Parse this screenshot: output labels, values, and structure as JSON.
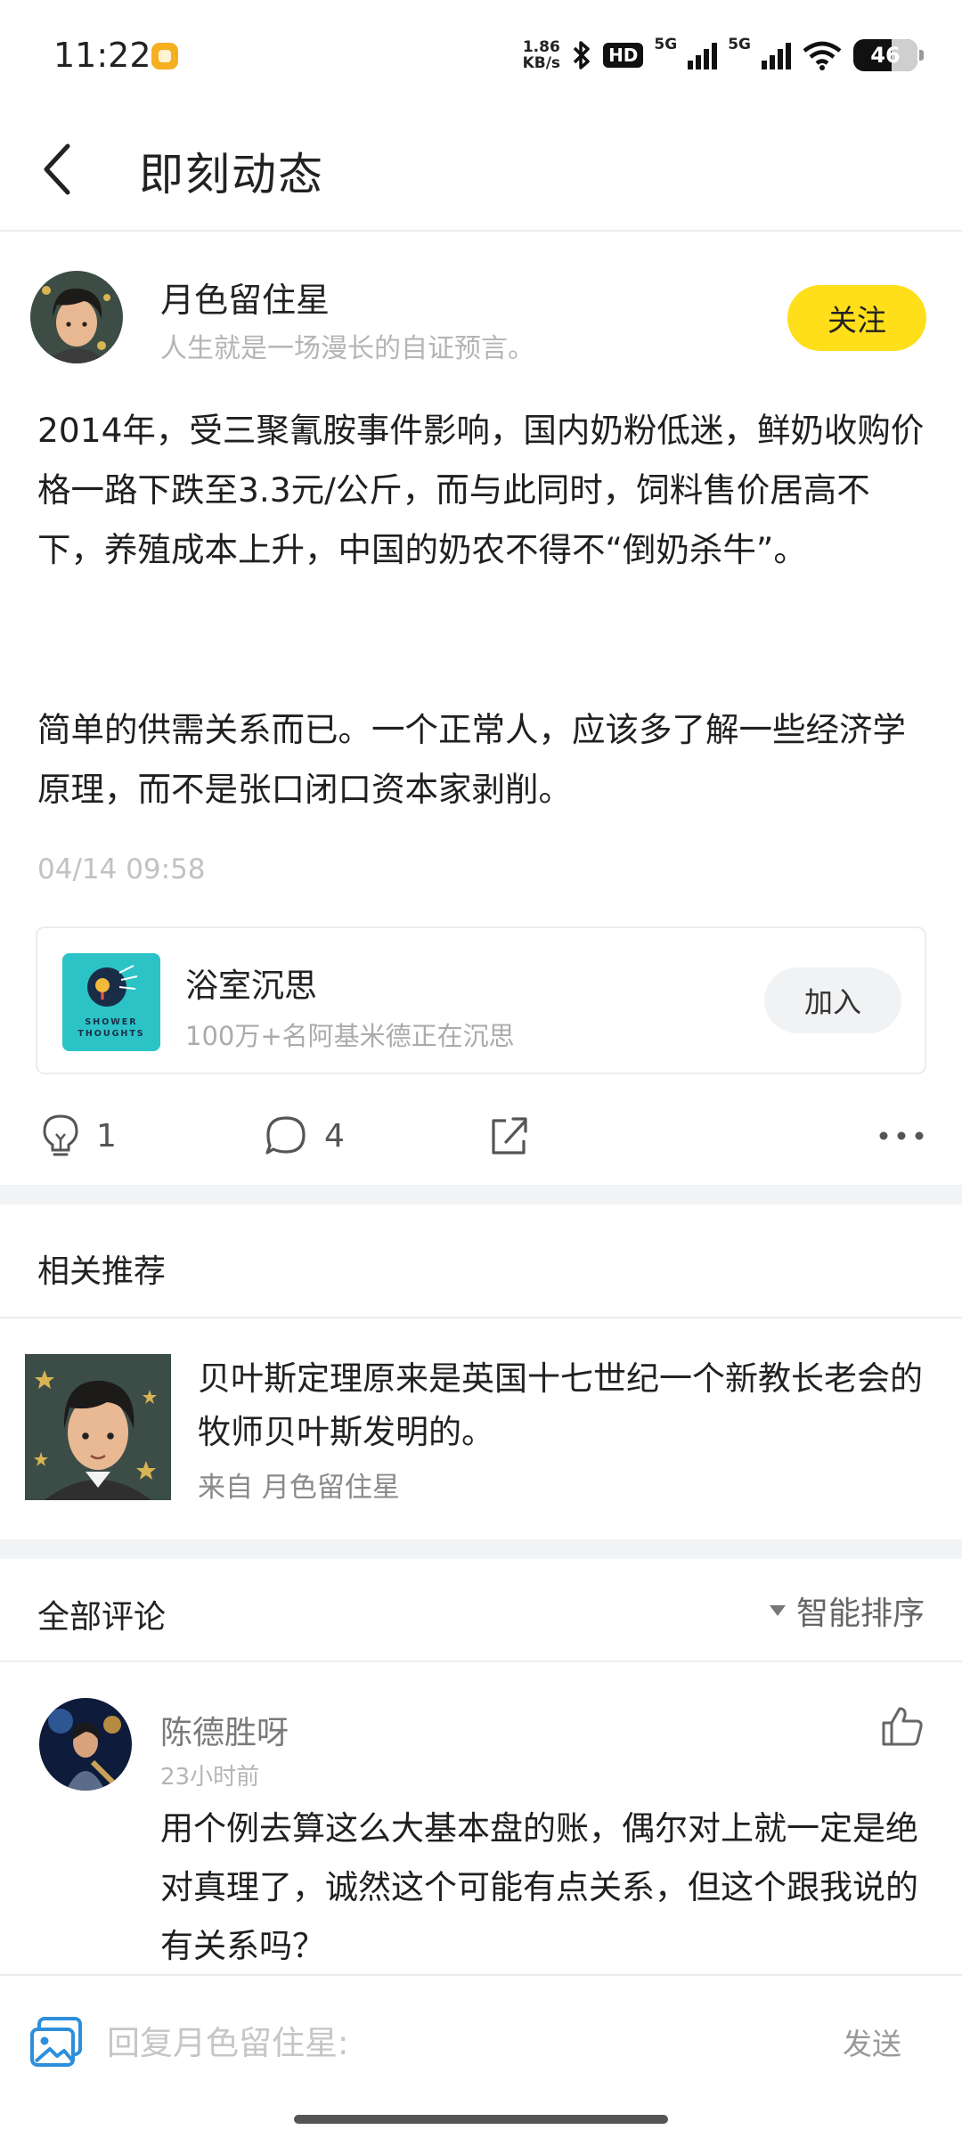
{
  "status_bar": {
    "time": "11:22",
    "net_speed_value": "1.86",
    "net_speed_unit": "KB/s",
    "hd_label": "HD",
    "net1": "5G",
    "net2": "5G",
    "battery": "46"
  },
  "header": {
    "title": "即刻动态"
  },
  "post": {
    "author_name": "月色留住星",
    "author_signature": "人生就是一场漫长的自证预言。",
    "follow_label": "关注",
    "paragraph1": "2014年，受三聚氰胺事件影响，国内奶粉低迷，鲜奶收购价格一路下跌至3.3元/公斤，而与此同时，饲料售价居高不下，养殖成本上升，中国的奶农不得不“倒奶杀牛”。",
    "paragraph2": "简单的供需关系而已。一个正常人，应该多了解一些经济学原理，而不是张口闭口资本家剥削。",
    "time": "04/14 09:58"
  },
  "topic": {
    "name": "浴室沉思",
    "desc": "100万+名阿基米德正在沉思",
    "logo_text_line1": "SHOWER",
    "logo_text_line2": "THOUGHTS",
    "join_label": "加入",
    "brand_color": "#2cc3c6"
  },
  "actions": {
    "like_count": "1",
    "comment_count": "4"
  },
  "related": {
    "section_title": "相关推荐",
    "item_text": "贝叶斯定理原来是英国十七世纪一个新教长老会的牧师贝叶斯发明的。",
    "item_from": "来自 月色留住星"
  },
  "comments": {
    "section_title": "全部评论",
    "sort_label": "智能排序",
    "items": [
      {
        "name": "陈德胜呀",
        "time": "23小时前",
        "text": "用个例去算这么大基本盘的账，偶尔对上就一定是绝对真理了，诚然这个可能有点关系，但这个跟我说的有关系吗？"
      }
    ]
  },
  "reply": {
    "placeholder": "回复月色留住星:",
    "send_label": "发送"
  },
  "colors": {
    "accent": "#ffde1a",
    "divider": "#ececec",
    "band": "#f2f3f5"
  }
}
